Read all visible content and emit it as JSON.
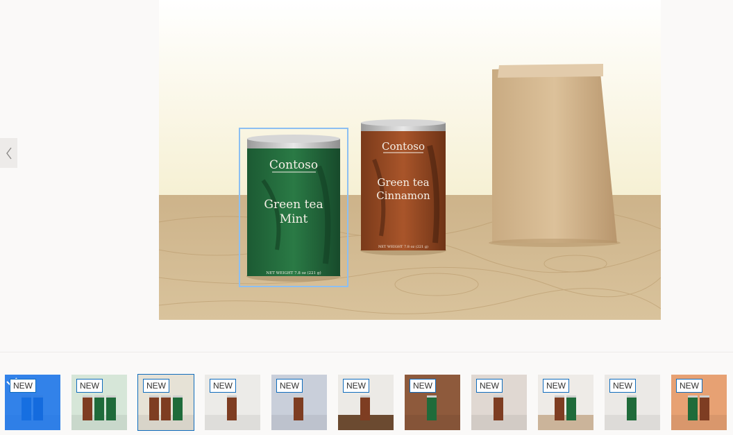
{
  "main_image": {
    "alt": "",
    "tins": [
      {
        "brand": "Contoso",
        "line1": "Green tea",
        "line2": "Mint",
        "weight": "NET WEIGHT 7.8 oz (221 g)"
      },
      {
        "brand": "Contoso",
        "line1": "Green tea",
        "line2": "Cinnamon",
        "weight": "NET WEIGHT 7.8 oz (221 g)"
      }
    ]
  },
  "thumbnails": [
    {
      "badge": "NEW",
      "selected": true,
      "bg": "#cfe0f5"
    },
    {
      "badge": "NEW",
      "selected": false,
      "bg": "#d6e6d8"
    },
    {
      "badge": "NEW",
      "selected": false,
      "bg": "#e6e2d6"
    },
    {
      "badge": "NEW",
      "selected": false,
      "bg": "#ecebe8"
    },
    {
      "badge": "NEW",
      "selected": false,
      "bg": "#c9cfda"
    },
    {
      "badge": "NEW",
      "selected": false,
      "bg": "#eceae6"
    },
    {
      "badge": "NEW",
      "selected": false,
      "bg": "#8e5a3c"
    },
    {
      "badge": "NEW",
      "selected": false,
      "bg": "#e0d8d2"
    },
    {
      "badge": "NEW",
      "selected": false,
      "bg": "#eeebe7"
    },
    {
      "badge": "NEW",
      "selected": false,
      "bg": "#ebe9e6"
    },
    {
      "badge": "NEW",
      "selected": false,
      "bg": "#e7a173"
    }
  ],
  "colors": {
    "accent": "#0f6cbd",
    "selection": "#1a6ef5"
  }
}
